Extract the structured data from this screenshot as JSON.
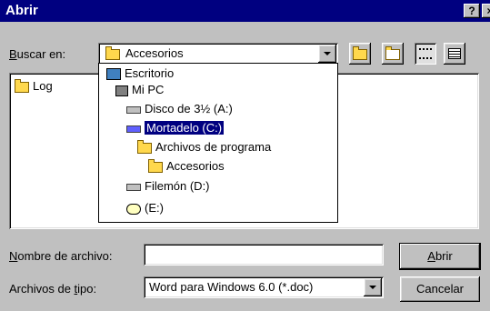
{
  "window": {
    "title": "Abrir",
    "help_label": "?",
    "close_label": "×"
  },
  "lookin": {
    "label": "Buscar en:",
    "underline_char": "B",
    "rest": "uscar en:",
    "value": "Accesorios"
  },
  "toolbar": {
    "up_icon": "folder-up-icon",
    "newfolder_icon": "new-folder-icon",
    "list_icon": "list-view-icon",
    "details_icon": "details-view-icon"
  },
  "file_list": [
    {
      "name": "Log",
      "icon": "folder-icon"
    }
  ],
  "dropdown": [
    {
      "label": "Escritorio",
      "icon": "desktop-icon"
    },
    {
      "label": "Mi PC",
      "icon": "computer-icon"
    },
    {
      "label": "Disco de 3½ (A:)",
      "icon": "floppy-drive-icon"
    },
    {
      "label": "Mortadelo (C:)",
      "icon": "hard-drive-icon",
      "selected": true
    },
    {
      "label": "Archivos de programa",
      "icon": "folder-icon"
    },
    {
      "label": "Accesorios",
      "icon": "open-folder-icon"
    },
    {
      "label": "Filemón (D:)",
      "icon": "hard-drive-icon"
    },
    {
      "label": "(E:)",
      "icon": "cd-drive-icon"
    }
  ],
  "filename": {
    "label_u": "N",
    "label_rest": "ombre de archivo:",
    "value": ""
  },
  "filetype": {
    "label_pre": "Archivos de ",
    "label_u": "t",
    "label_rest": "ipo:",
    "value": "Word para Windows 6.0 (*.doc)"
  },
  "buttons": {
    "open_u": "A",
    "open_rest": "brir",
    "cancel": "Cancelar"
  }
}
